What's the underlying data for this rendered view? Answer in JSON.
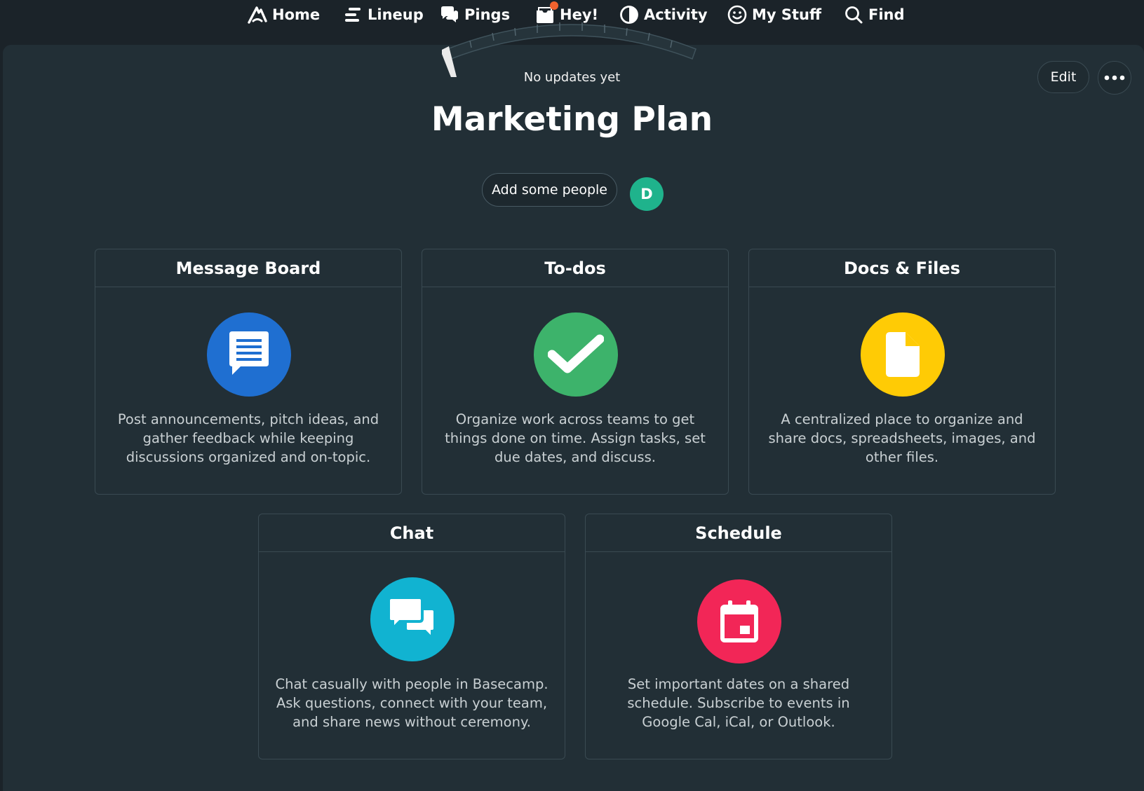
{
  "nav": {
    "items": [
      {
        "label": "Home",
        "icon": "basecamp-logo-icon"
      },
      {
        "label": "Lineup",
        "icon": "lineup-icon"
      },
      {
        "label": "Pings",
        "icon": "pings-icon"
      },
      {
        "label": "Hey!",
        "icon": "hey-inbox-icon"
      },
      {
        "label": "Activity",
        "icon": "activity-icon"
      },
      {
        "label": "My Stuff",
        "icon": "smiley-icon"
      },
      {
        "label": "Find",
        "icon": "search-icon"
      }
    ]
  },
  "project": {
    "status": "No updates yet",
    "title": "Marketing Plan",
    "edit_label": "Edit",
    "add_people_label": "Add some people",
    "avatar_initial": "D"
  },
  "tools": [
    {
      "title": "Message Board",
      "description": "Post announcements, pitch ideas, and gather feedback while keeping discussions organized and on-topic.",
      "color": "#1f6fd1",
      "icon": "message-board-icon"
    },
    {
      "title": "To-dos",
      "description": "Organize work across teams to get things done on time. Assign tasks, set due dates, and discuss.",
      "color": "#3db36b",
      "icon": "checkmark-icon"
    },
    {
      "title": "Docs & Files",
      "description": "A centralized place to organize and share docs, spreadsheets, images, and other files.",
      "color": "#ffcb05",
      "icon": "document-icon"
    },
    {
      "title": "Chat",
      "description": "Chat casually with people in Basecamp. Ask questions, connect with your team, and share news without ceremony.",
      "color": "#11b3d1",
      "icon": "chat-bubbles-icon"
    },
    {
      "title": "Schedule",
      "description": "Set important dates on a shared schedule. Subscribe to events in Google Cal, iCal, or Outlook.",
      "color": "#f22657",
      "icon": "calendar-icon"
    }
  ],
  "colors": {
    "nav_bg": "#1b2329",
    "panel_bg": "#222f36",
    "border": "#3a4a52",
    "avatar": "#1fb38c",
    "notification": "#f2622e"
  }
}
